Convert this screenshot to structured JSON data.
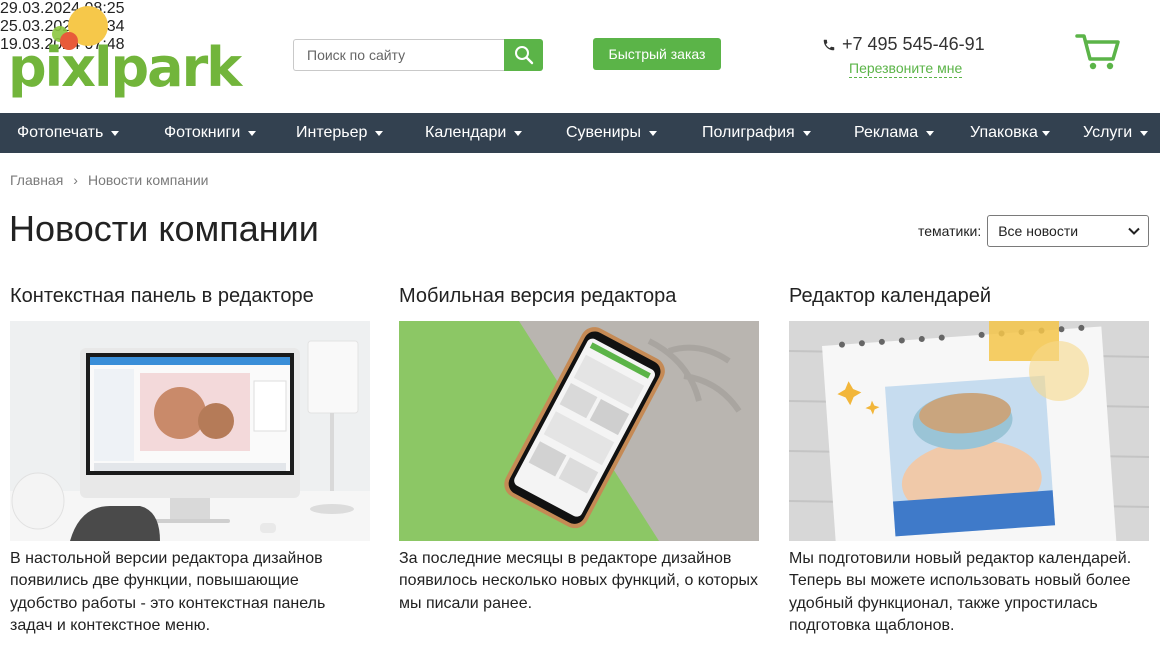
{
  "header": {
    "logo_text": "pixlpark",
    "search": {
      "placeholder": "Поиск по сайту"
    },
    "quick_order": "Быстрый заказ",
    "phone": "+7 495 545-46-91",
    "callback": "Перезвоните мне"
  },
  "nav": {
    "items": [
      {
        "label": "Фотопечать"
      },
      {
        "label": "Фотокниги"
      },
      {
        "label": "Интерьер"
      },
      {
        "label": "Календари"
      },
      {
        "label": "Сувениры"
      },
      {
        "label": "Полиграфия"
      },
      {
        "label": "Реклама"
      },
      {
        "label": "Упаковка"
      },
      {
        "label": "Услуги"
      }
    ]
  },
  "breadcrumb": {
    "home": "Главная",
    "separator": "›",
    "current": "Новости компании"
  },
  "page": {
    "title": "Новости компании",
    "filter_label": "тематики:",
    "filter_value": "Все новости"
  },
  "articles": [
    {
      "title": "Контекстная панель в редакторе",
      "text": "В настольной версии редактора дизайнов появились две функции, повышающие удобство работы - это контекстная панель задач и контекстное меню.",
      "date": "29.03.2024 08:25"
    },
    {
      "title": "Мобильная версия редактора",
      "text": "За последние месяцы в редакторе дизайнов появилось несколько новых функций, о которых мы писали ранее.",
      "date": "25.03.2024 06:34"
    },
    {
      "title": "Редактор календарей",
      "text": "Мы подготовили новый редактор календарей. Теперь вы можете использовать новый более удобный функционал, также упростилась подготовка щаблонов.",
      "date": "19.03.2024 07:48"
    }
  ],
  "colors": {
    "brand_green": "#5bb448",
    "nav_bg": "#334150"
  },
  "icons": {
    "search": "search-icon",
    "phone": "phone-icon",
    "cart": "cart-icon",
    "dropdown": "chevron-down-icon"
  }
}
